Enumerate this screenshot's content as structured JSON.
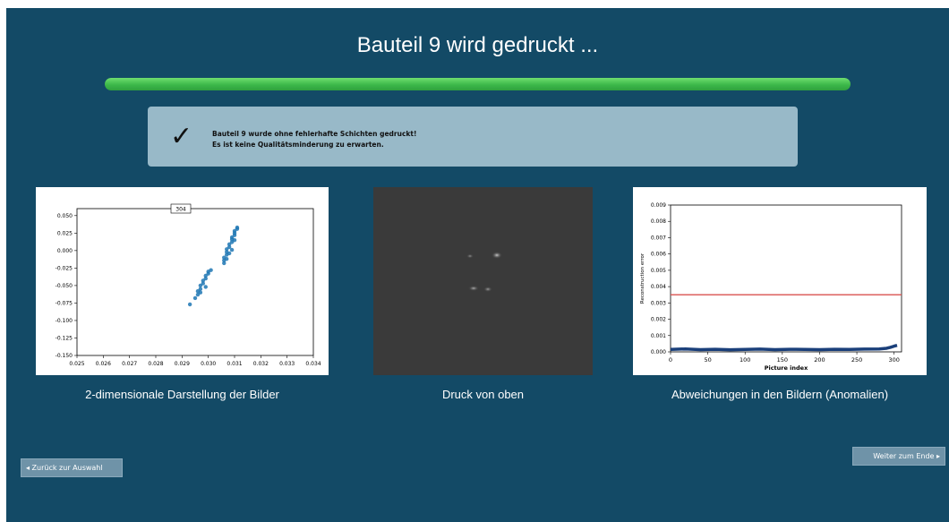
{
  "title": "Bauteil 9 wird gedruckt ...",
  "progress": {
    "percent": 100,
    "color": "#3cb84a"
  },
  "status": {
    "icon": "check-icon",
    "line1": "Bauteil 9 wurde ohne fehlerhafte Schichten gedruckt!",
    "line2": "Es ist keine Qualitätsminderung zu erwarten."
  },
  "panels": {
    "left_caption": "2-dimensionale Darstellung der Bilder",
    "middle_caption": "Druck von oben",
    "right_caption": "Abweichungen in den Bildern (Anomalien)"
  },
  "nav": {
    "back_label": "◂ Zurück zur Auswahl",
    "next_label": "Weiter zum Ende ▸"
  },
  "chart_data": [
    {
      "type": "scatter",
      "annotation": "304",
      "xlim": [
        0.025,
        0.034
      ],
      "ylim": [
        -0.15,
        0.06
      ],
      "xticks": [
        0.025,
        0.026,
        0.027,
        0.028,
        0.029,
        0.03,
        0.031,
        0.032,
        0.033,
        0.034
      ],
      "yticks": [
        0.05,
        0.025,
        0.0,
        -0.025,
        -0.05,
        -0.075,
        -0.1,
        -0.125,
        -0.15
      ],
      "color": "#1f77b4",
      "points": [
        [
          0.0293,
          -0.077
        ],
        [
          0.0295,
          -0.068
        ],
        [
          0.0296,
          -0.063
        ],
        [
          0.0296,
          -0.058
        ],
        [
          0.0297,
          -0.055
        ],
        [
          0.0297,
          -0.05
        ],
        [
          0.0298,
          -0.047
        ],
        [
          0.0298,
          -0.043
        ],
        [
          0.0299,
          -0.04
        ],
        [
          0.0299,
          -0.036
        ],
        [
          0.03,
          -0.033
        ],
        [
          0.03,
          -0.03
        ],
        [
          0.0301,
          -0.028
        ],
        [
          0.0297,
          -0.06
        ],
        [
          0.0299,
          -0.052
        ],
        [
          0.0306,
          -0.018
        ],
        [
          0.0306,
          -0.014
        ],
        [
          0.0306,
          -0.01
        ],
        [
          0.0307,
          -0.006
        ],
        [
          0.0307,
          -0.002
        ],
        [
          0.0307,
          0.002
        ],
        [
          0.0308,
          0.005
        ],
        [
          0.0308,
          0.009
        ],
        [
          0.0309,
          0.012
        ],
        [
          0.0309,
          0.016
        ],
        [
          0.0309,
          0.019
        ],
        [
          0.031,
          0.022
        ],
        [
          0.031,
          0.025
        ],
        [
          0.031,
          0.028
        ],
        [
          0.0311,
          0.031
        ],
        [
          0.0311,
          0.033
        ],
        [
          0.0308,
          -0.004
        ],
        [
          0.0309,
          0.001
        ],
        [
          0.031,
          0.015
        ],
        [
          0.0307,
          -0.012
        ]
      ]
    },
    {
      "type": "line",
      "xlabel": "Picture index",
      "ylabel": "Reconstruction error",
      "xlim": [
        0,
        310
      ],
      "ylim": [
        0,
        0.009
      ],
      "xticks": [
        0,
        50,
        100,
        150,
        200,
        250,
        300
      ],
      "yticks": [
        0.0,
        0.001,
        0.002,
        0.003,
        0.004,
        0.005,
        0.006,
        0.007,
        0.008,
        0.009
      ],
      "threshold": {
        "value": 0.0035,
        "color": "#d9534f"
      },
      "series_color": "#1a3f7a",
      "x": [
        0,
        20,
        40,
        60,
        80,
        100,
        120,
        140,
        160,
        180,
        200,
        220,
        240,
        260,
        280,
        290,
        295,
        300,
        304
      ],
      "values": [
        0.00015,
        0.00018,
        0.00014,
        0.00016,
        0.00013,
        0.00015,
        0.00017,
        0.00014,
        0.00016,
        0.00015,
        0.00014,
        0.00016,
        0.00015,
        0.00017,
        0.00018,
        0.00022,
        0.00028,
        0.00035,
        0.0004
      ]
    }
  ]
}
